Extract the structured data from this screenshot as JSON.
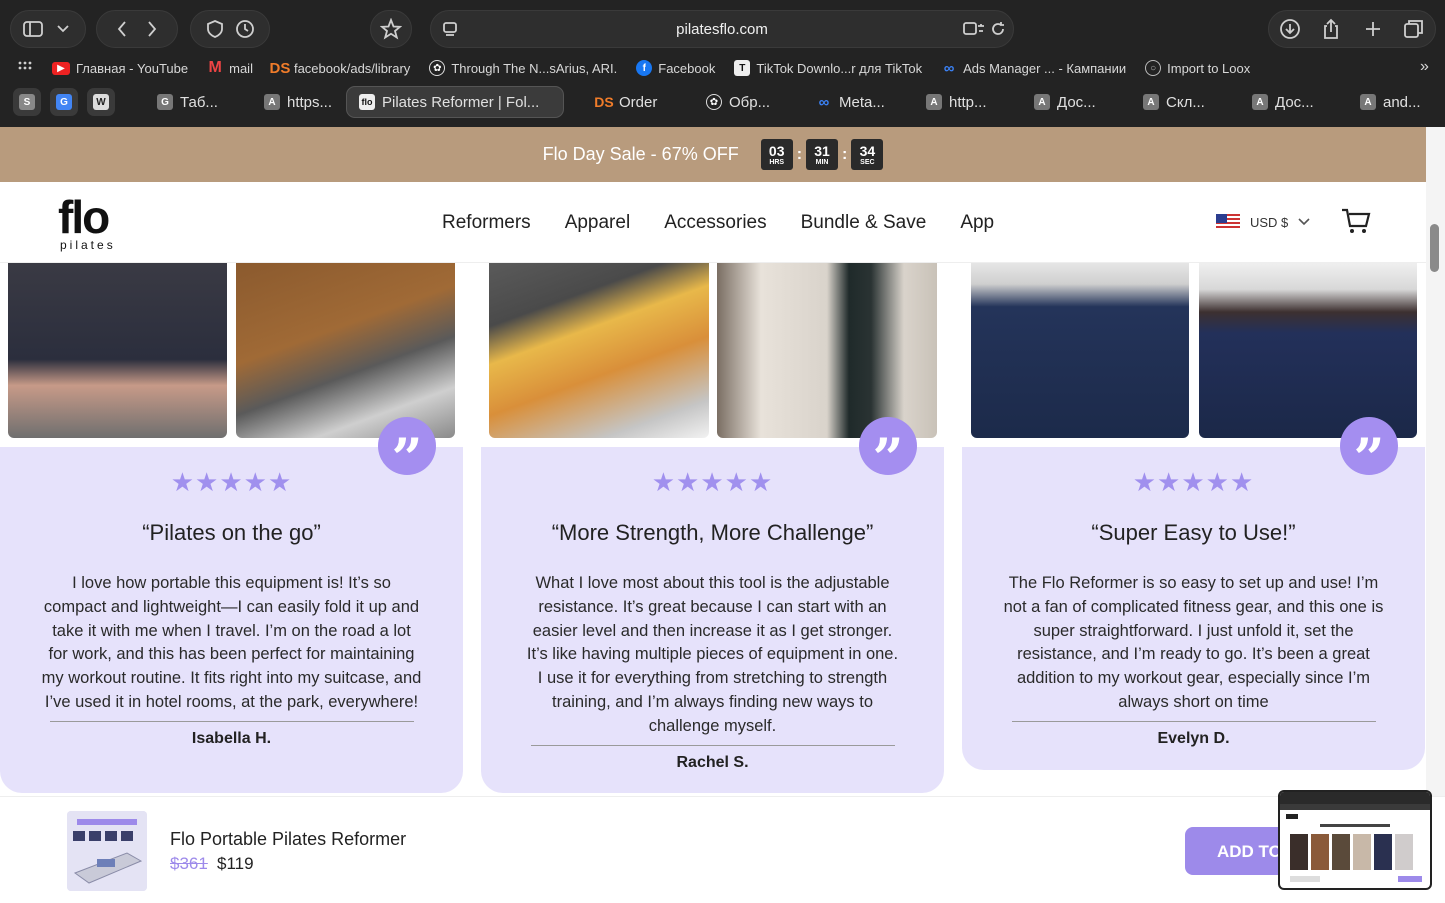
{
  "browser": {
    "url": "pilatesflo.com",
    "bookmarks": [
      "Главная - YouTube",
      "mail",
      "facebook/ads/library",
      "Through The N...sArius, ARI.",
      "Facebook",
      "TikTok Downlo...r для TikTok",
      "Ads Manager ... - Кампании",
      "Import to Loox"
    ],
    "pinned_tabs": [
      "S",
      "G",
      "W"
    ],
    "tabs": [
      "Таб...",
      "https...",
      "Pilates Reformer | Fol...",
      "Order",
      "Обр...",
      "Meta...",
      "http...",
      "Дос...",
      "Скл...",
      "Дос...",
      "and..."
    ]
  },
  "sale": {
    "text": "Flo Day Sale - 67% OFF",
    "hrs": "03",
    "hrs_label": "HRS",
    "min": "31",
    "min_label": "MIN",
    "sec": "34",
    "sec_label": "SEC"
  },
  "header": {
    "logo": "flo",
    "logo_sub": "pilates",
    "menu": [
      "Reformers",
      "Apparel",
      "Accessories",
      "Bundle & Save",
      "App"
    ],
    "currency": "USD $"
  },
  "reviews": [
    {
      "stars": "★★★★★",
      "title": "“Pilates on the go”",
      "body": "I love how portable this equipment is! It’s so compact and lightweight—I can easily fold it up and take it with me when I travel. I’m on the road a lot for work, and this has been perfect for maintaining my workout routine. It fits right into my suitcase, and I’ve used it in hotel rooms, at the park, everywhere!",
      "author": "Isabella H."
    },
    {
      "stars": "★★★★★",
      "title": "“More Strength, More Challenge”",
      "body": "What I love most about this tool is the adjustable resistance. It’s great because I can start with an easier level and then increase it as I get stronger. It’s like having multiple pieces of equipment in one. I use it for everything from stretching to strength training, and I’m always finding new ways to challenge myself.",
      "author": "Rachel S."
    },
    {
      "stars": "★★★★★",
      "title": "“Super Easy to Use!”",
      "body": "The Flo Reformer is so easy to set up and use! I’m not a fan of complicated fitness gear, and this one is super straightforward. I just unfold it, set the resistance, and I’m ready to go. It’s been a great addition to my workout gear, especially since I’m always short on time",
      "author": "Evelyn D."
    }
  ],
  "sticky": {
    "product_name": "Flo Portable Pilates Reformer",
    "old_price": "$361",
    "new_price": "$119",
    "button": "ADD TO CART"
  },
  "colors": {
    "accent": "#9d8aea",
    "card_bg": "#e6e2fb",
    "sale_bar": "#b89b7d"
  }
}
